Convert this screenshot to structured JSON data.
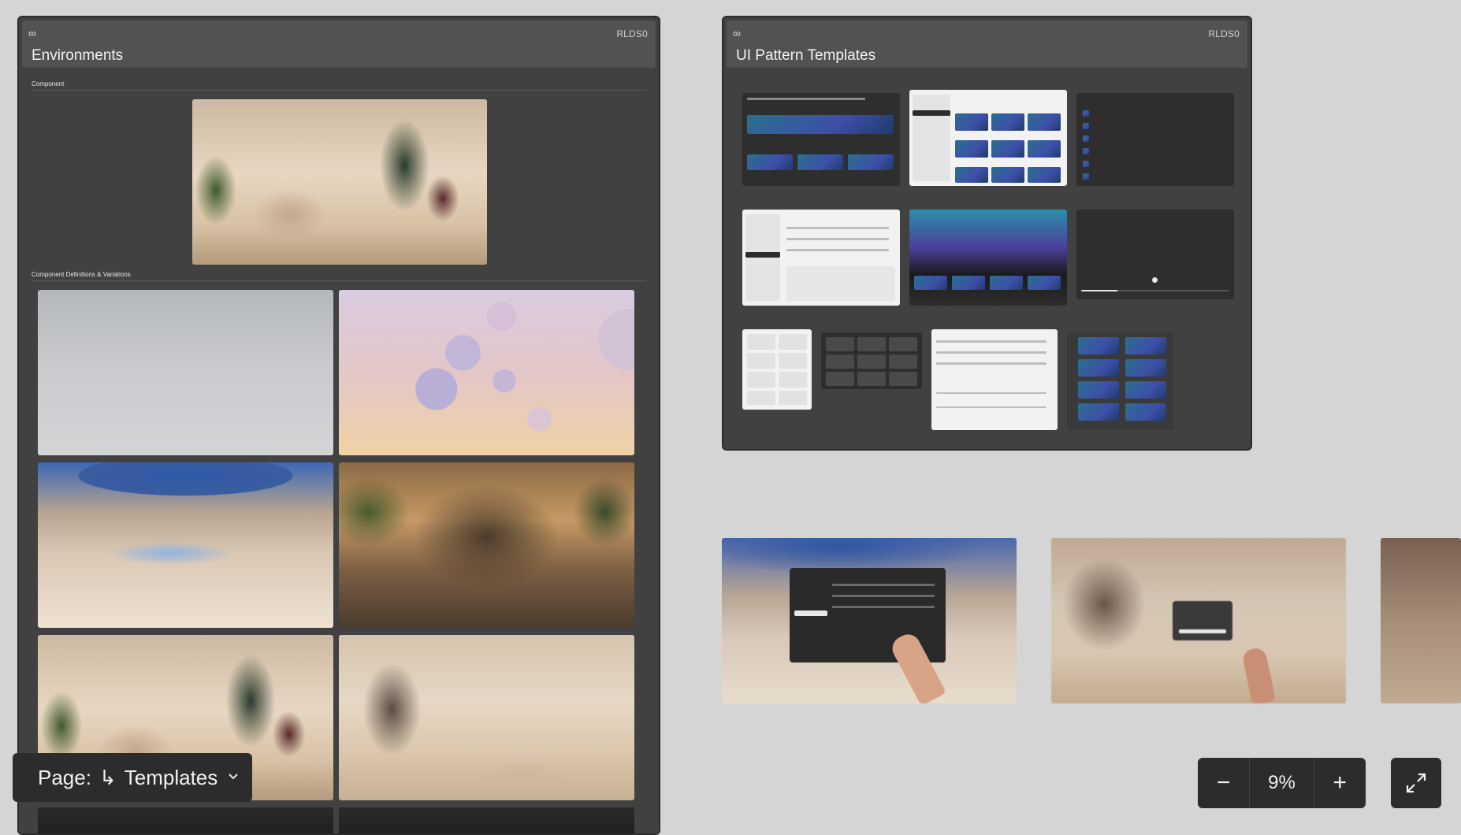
{
  "frames": {
    "environments": {
      "logo": "∞",
      "badge": "RLDS0",
      "title": "Environments",
      "section_component": "Component",
      "section_definitions": "Component Definitions & Variations"
    },
    "ui_patterns": {
      "logo": "∞",
      "badge": "RLDS0",
      "title": "UI Pattern Templates"
    }
  },
  "page_selector": {
    "label": "Page:",
    "arrow": "↳",
    "value": "Templates",
    "icon": "chevron-down-icon"
  },
  "zoom": {
    "minus": "−",
    "value": "9%",
    "plus": "+",
    "expand_icon": "expand-icon"
  },
  "colors": {
    "canvas": "#d5d5d5",
    "frame": "#414141",
    "frame_header": "#525252",
    "control_bg": "#2c2c2c"
  }
}
